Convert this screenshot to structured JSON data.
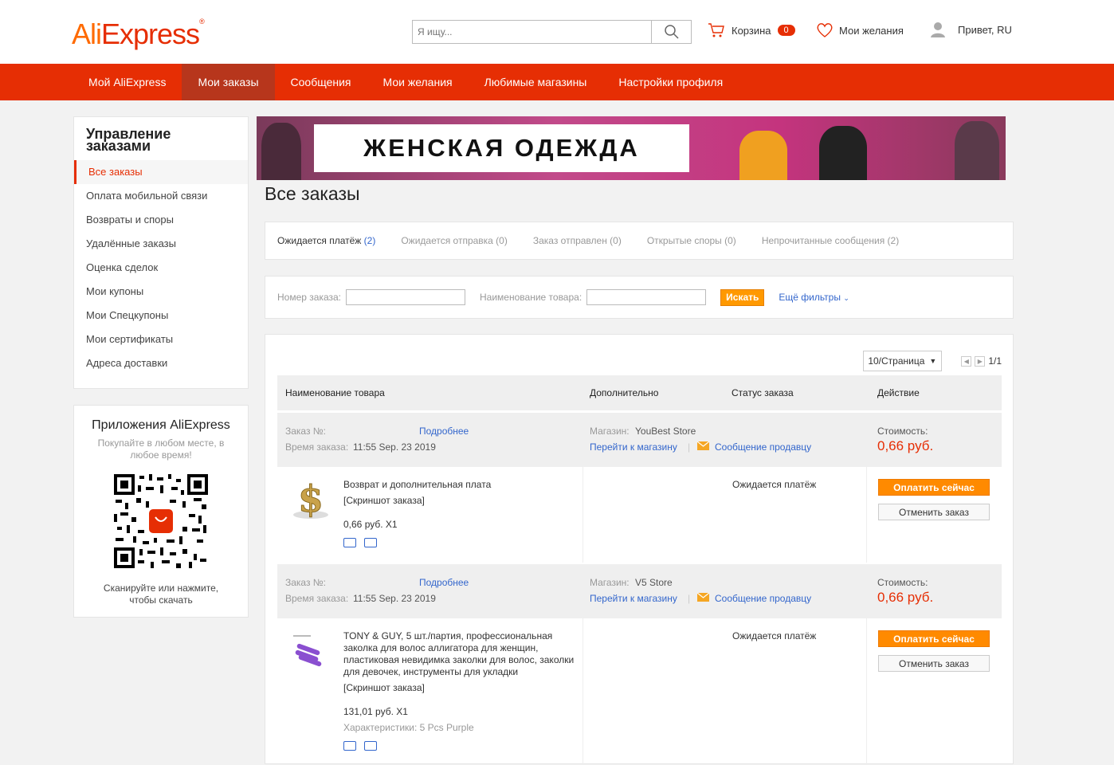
{
  "header": {
    "logo_ali": "Ali",
    "logo_express": "Express",
    "logo_tm": "®",
    "search_placeholder": "Я ищу...",
    "cart_label": "Корзина",
    "cart_count": "0",
    "wishlist_label": "Мои желания",
    "greeting": "Привет, RU"
  },
  "nav": {
    "items": [
      "Мой AliExpress",
      "Мои заказы",
      "Сообщения",
      "Мои желания",
      "Любимые магазины",
      "Настройки профиля"
    ],
    "active_index": 1
  },
  "sidebar": {
    "title": "Управление заказами",
    "items": [
      "Все заказы",
      "Оплата мобильной связи",
      "Возвраты и споры",
      "Удалённые заказы",
      "Оценка сделок",
      "Мои купоны",
      "Мои Спецкупоны",
      "Мои сертификаты",
      "Адреса доставки"
    ]
  },
  "app_box": {
    "title": "Приложения AliExpress",
    "subtitle": "Покупайте в любом месте, в любое время!",
    "scan_text": "Сканируйте или нажмите, чтобы скачать"
  },
  "banner": {
    "text": "ЖЕНСКАЯ ОДЕЖДА"
  },
  "page_title": "Все заказы",
  "tabs": [
    {
      "label": "Ожидается платёж ",
      "count": "(2)"
    },
    {
      "label": "Ожидается отправка (0)",
      "count": ""
    },
    {
      "label": "Заказ отправлен (0)",
      "count": ""
    },
    {
      "label": "Открытые споры (0)",
      "count": ""
    },
    {
      "label": "Непрочитанные сообщения (2)",
      "count": ""
    }
  ],
  "filters": {
    "order_number_label": "Номер заказа:",
    "product_name_label": "Наименование товара:",
    "search_button": "Искать",
    "more_filters": "Ещё фильтры"
  },
  "pager": {
    "per_page": "10/Страница",
    "pages": "1/1"
  },
  "table_header": {
    "product": "Наименование товара",
    "extra": "Дополнительно",
    "status": "Статус заказа",
    "action": "Действие"
  },
  "orders": [
    {
      "order_no_label": "Заказ №:",
      "details_link": "Подробнее",
      "time_label": "Время заказа:",
      "time": "11:55 Sep. 23 2019",
      "store_label": "Магазин:",
      "store": "YouBest Store",
      "go_store": "Перейти к магазину",
      "message_seller": "Сообщение продавцу",
      "cost_label": "Стоимость:",
      "cost": "0,66 руб.",
      "product_name": "Возврат и дополнительная плата",
      "snapshot": "[Скриншот заказа]",
      "qty_price": "0,66 руб. X1",
      "characteristics": "",
      "status": "Ожидается платёж",
      "pay_button": "Оплатить сейчас",
      "cancel_button": "Отменить заказ"
    },
    {
      "order_no_label": "Заказ №:",
      "details_link": "Подробнее",
      "time_label": "Время заказа:",
      "time": "11:55 Sep. 23 2019",
      "store_label": "Магазин:",
      "store": "V5 Store",
      "go_store": "Перейти к магазину",
      "message_seller": "Сообщение продавцу",
      "cost_label": "Стоимость:",
      "cost": "0,66 руб.",
      "product_name": "TONY & GUY, 5 шт./партия, профессиональная заколка для волос аллигатора для женщин, пластиковая невидимка заколки для волос, заколки для девочек, инструменты для укладки",
      "snapshot": "[Скриншот заказа]",
      "qty_price": "131,01 руб. X1",
      "characteristics": "Характеристики: 5 Pcs Purple",
      "status": "Ожидается платёж",
      "pay_button": "Оплатить сейчас",
      "cancel_button": "Отменить заказ"
    }
  ],
  "colors": {
    "brand_red": "#e62e04",
    "orange": "#ff8a00",
    "link": "#3366cc"
  }
}
